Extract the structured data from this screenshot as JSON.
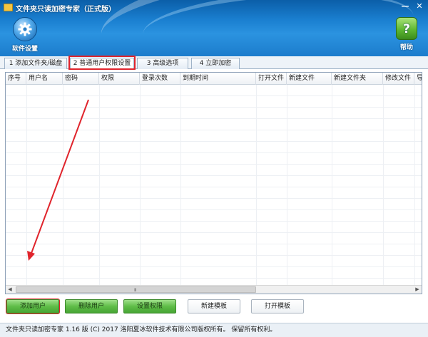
{
  "window": {
    "title": "文件夹只读加密专家（正式版）",
    "controls": [
      "—",
      "✕"
    ]
  },
  "toolbar": {
    "settings_label": "软件设置",
    "help_label": "帮助"
  },
  "tabs": [
    {
      "label": "1 添加文件夹/磁盘"
    },
    {
      "label": "2 普通用户权限设置"
    },
    {
      "label": "3 高级选项"
    },
    {
      "label": "4 立即加密"
    }
  ],
  "table": {
    "columns": [
      "序号",
      "用户名",
      "密码",
      "权限",
      "登录次数",
      "到期时间",
      "打开文件",
      "新建文件",
      "新建文件夹",
      "修改文件",
      "导"
    ],
    "scroll_grip": "III"
  },
  "buttons": {
    "add_user": "添加用户",
    "delete_user": "删除用户",
    "set_permission": "设置权限",
    "new_template": "新建模板",
    "open_template": "打开模板"
  },
  "status": {
    "text": "文件夹只读加密专家 1.16 版  (C)  2017 洛阳夏冰软件技术有限公司版权所有。 保留所有权利。"
  },
  "colors": {
    "header": "#1a7fd0",
    "highlight": "#e0242c",
    "green_button": "#5fbd48"
  }
}
